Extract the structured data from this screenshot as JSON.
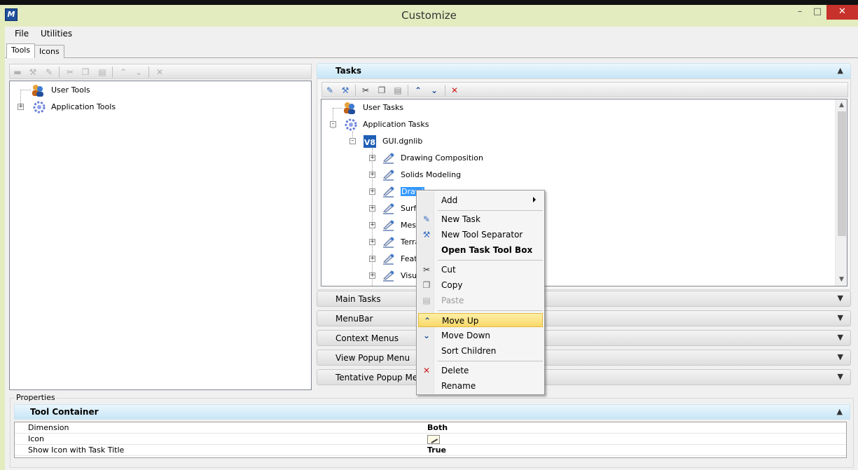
{
  "window": {
    "title": "Customize",
    "minimize": "–",
    "maximize": "□",
    "close": "✕"
  },
  "menu": {
    "file": "File",
    "utilities": "Utilities"
  },
  "tabs": {
    "tools": "Tools",
    "icons": "Icons"
  },
  "left_tree": {
    "user_tools": "User Tools",
    "application_tools": "Application Tools"
  },
  "tasks_panel": {
    "header": "Tasks",
    "tree": {
      "user_tasks": "User Tasks",
      "application_tasks": "Application Tasks",
      "library": "GUI.dgnlib",
      "children": [
        "Drawing Composition",
        "Solids Modeling",
        "Drawi",
        "Surfa",
        "Mesh",
        "Terra",
        "Feat",
        "Visua"
      ]
    }
  },
  "collapsed_panels": [
    "Main Tasks",
    "MenuBar",
    "Context Menus",
    "View Popup Menu",
    "Tentative Popup Men"
  ],
  "context_menu": {
    "add": "Add",
    "new_task": "New Task",
    "new_tool_separator": "New Tool Separator",
    "open_task_tool_box": "Open Task Tool Box",
    "cut": "Cut",
    "copy": "Copy",
    "paste": "Paste",
    "move_up": "Move Up",
    "move_down": "Move Down",
    "sort_children": "Sort Children",
    "delete": "Delete",
    "rename": "Rename"
  },
  "properties": {
    "label": "Properties",
    "header": "Tool Container",
    "rows": [
      {
        "name": "Dimension",
        "value": "Both"
      },
      {
        "name": "Icon",
        "value": ""
      },
      {
        "name": "Show Icon with Task Title",
        "value": "True"
      }
    ]
  },
  "colors": {
    "accent_blue": "#3399ff",
    "delete_red": "#d11a1a",
    "highlight": "#f9d868"
  }
}
